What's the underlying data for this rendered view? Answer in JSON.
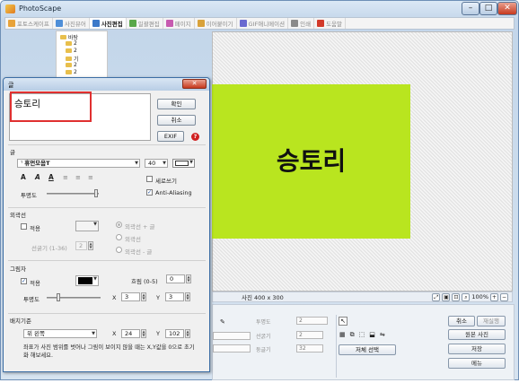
{
  "window": {
    "title": "PhotoScape",
    "min": "–",
    "max": "□",
    "close": "✕"
  },
  "tabs": [
    {
      "label": "포토스케이프",
      "active": false,
      "icon": "photoscape-icon",
      "color": "#e8a33a"
    },
    {
      "label": "사진뷰어",
      "active": false,
      "icon": "viewer-icon",
      "color": "#4f8fd8"
    },
    {
      "label": "사진편집",
      "active": true,
      "icon": "editor-icon",
      "color": "#3c79c9"
    },
    {
      "label": "일괄편집",
      "active": false,
      "icon": "batch-icon",
      "color": "#5aa84a"
    },
    {
      "label": "페이지",
      "active": false,
      "icon": "page-icon",
      "color": "#c75bb0"
    },
    {
      "label": "이어붙이기",
      "active": false,
      "icon": "combine-icon",
      "color": "#d9a23a"
    },
    {
      "label": "GIF애니메이션",
      "active": false,
      "icon": "gif-icon",
      "color": "#6a6ad0"
    },
    {
      "label": "인쇄",
      "active": false,
      "icon": "print-icon",
      "color": "#8a8a8a"
    },
    {
      "label": "도움말",
      "active": false,
      "icon": "help-icon",
      "color": "#d23a2a"
    }
  ],
  "tree": {
    "root": "바탕",
    "items": [
      "2",
      "2",
      "기",
      "2",
      "2",
      "2"
    ]
  },
  "photo": {
    "text": "승토리",
    "bg": "#b9e51f"
  },
  "statusbar": {
    "size": "사진 400 x 300",
    "zoom": "100%"
  },
  "bottom": {
    "opacity_label": "투명도",
    "opacity_value": "2",
    "line_label": "선굵기",
    "line_value": "2",
    "round_label": "둥글기",
    "round_value": "32",
    "full_select": "저체 선택",
    "cancel": "취소",
    "redo": "재실행",
    "original": "원본 사진",
    "save": "저장",
    "menu": "메뉴"
  },
  "dialog": {
    "title": "글",
    "text_value": "승토리",
    "ok": "확인",
    "cancel": "취소",
    "exif": "EXIF",
    "help": "?",
    "font_section": "글",
    "font_name": "휴먼모음T",
    "font_size": "40",
    "styles": [
      "A",
      "A",
      "A"
    ],
    "vertical": "세로쓰기",
    "antialias": "Anti-Aliasing",
    "opacity": "투명도",
    "outline_section": "외곽선",
    "outline_apply": "적용",
    "outline_thickness": "선굵기 (1-36)",
    "outline_thickness_value": "2",
    "outline_opt1": "외곽선 + 글",
    "outline_opt2": "외곽선",
    "outline_opt3": "외곽선 - 글",
    "shadow_section": "그림자",
    "shadow_apply": "적용",
    "blur_label": "흐림 (0-5)",
    "blur_value": "0",
    "shadow_opacity": "투명도",
    "shadow_x": "3",
    "shadow_y": "3",
    "layout_section": "배치기준",
    "layout_pos": "위 왼쪽",
    "layout_x": "24",
    "layout_y": "102",
    "note": "좌표가 사진 범위를 벗어나 그림이 보이지 않을 때는 X,Y값을 0으로 초기화 해보세요.",
    "x_label": "X",
    "y_label": "Y"
  },
  "colors": {
    "accent": "#3c6ea5",
    "highlight": "#e03030",
    "photo_bg": "#b9e51f"
  }
}
